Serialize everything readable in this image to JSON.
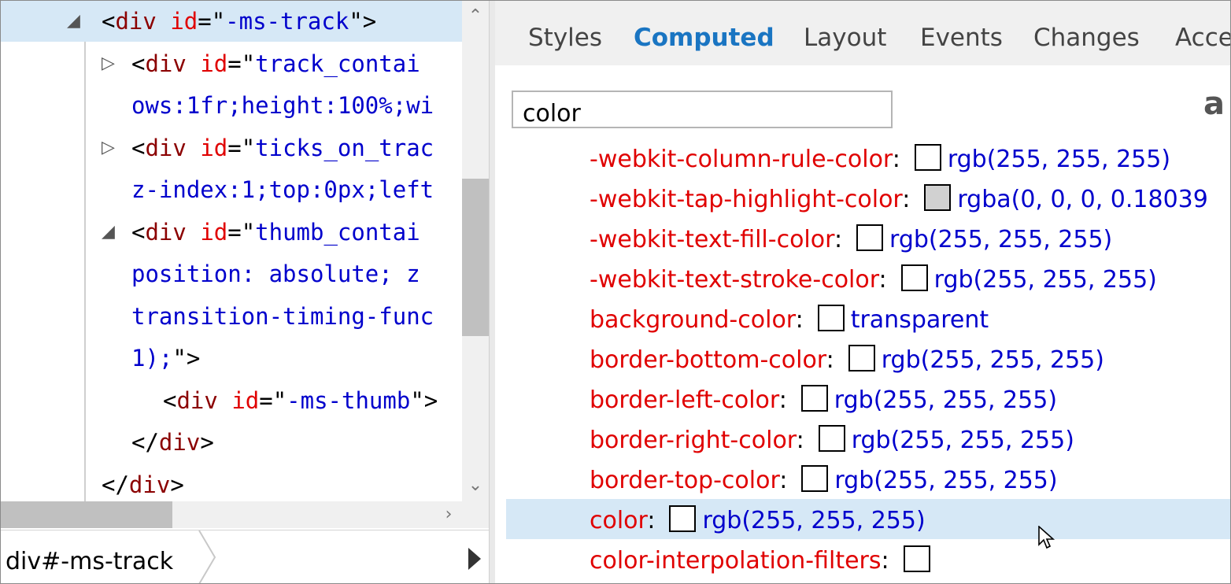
{
  "dom_tree": {
    "lines": [
      {
        "twisty": "expanded",
        "parts": [
          {
            "c": "punc",
            "t": "<"
          },
          {
            "c": "tag",
            "t": "div"
          },
          {
            "c": "punc",
            "t": " "
          },
          {
            "c": "attr",
            "t": "id"
          },
          {
            "c": "punc",
            "t": "=\""
          },
          {
            "c": "val",
            "t": "-ms-track"
          },
          {
            "c": "punc",
            "t": "\">"
          }
        ]
      },
      {
        "twisty": "collapsed",
        "parts": [
          {
            "c": "punc",
            "t": "<"
          },
          {
            "c": "tag",
            "t": "div"
          },
          {
            "c": "punc",
            "t": " "
          },
          {
            "c": "attr",
            "t": "id"
          },
          {
            "c": "punc",
            "t": "=\""
          },
          {
            "c": "val",
            "t": "track_contai"
          }
        ]
      },
      {
        "twisty": "",
        "parts": [
          {
            "c": "css",
            "t": "ows:1fr;height:100%;wi"
          }
        ]
      },
      {
        "twisty": "collapsed",
        "parts": [
          {
            "c": "punc",
            "t": "<"
          },
          {
            "c": "tag",
            "t": "div"
          },
          {
            "c": "punc",
            "t": " "
          },
          {
            "c": "attr",
            "t": "id"
          },
          {
            "c": "punc",
            "t": "=\""
          },
          {
            "c": "val",
            "t": "ticks_on_trac"
          }
        ]
      },
      {
        "twisty": "",
        "parts": [
          {
            "c": "css",
            "t": "z-index:1;top:0px;left"
          }
        ]
      },
      {
        "twisty": "expanded",
        "parts": [
          {
            "c": "punc",
            "t": "<"
          },
          {
            "c": "tag",
            "t": "div"
          },
          {
            "c": "punc",
            "t": " "
          },
          {
            "c": "attr",
            "t": "id"
          },
          {
            "c": "punc",
            "t": "=\""
          },
          {
            "c": "val",
            "t": "thumb_contai"
          }
        ]
      },
      {
        "twisty": "",
        "parts": [
          {
            "c": "css",
            "t": "position: absolute; z"
          }
        ]
      },
      {
        "twisty": "",
        "parts": [
          {
            "c": "css",
            "t": "transition-timing-func"
          }
        ]
      },
      {
        "twisty": "",
        "parts": [
          {
            "c": "css",
            "t": "1);"
          },
          {
            "c": "punc",
            "t": "\">"
          }
        ]
      },
      {
        "twisty": "",
        "parts": [
          {
            "c": "punc",
            "t": "<"
          },
          {
            "c": "tag",
            "t": "div"
          },
          {
            "c": "punc",
            "t": " "
          },
          {
            "c": "attr",
            "t": "id"
          },
          {
            "c": "punc",
            "t": "=\""
          },
          {
            "c": "val",
            "t": "-ms-thumb"
          },
          {
            "c": "punc",
            "t": "\">"
          }
        ]
      },
      {
        "twisty": "",
        "parts": [
          {
            "c": "punc",
            "t": "</"
          },
          {
            "c": "tag",
            "t": "div"
          },
          {
            "c": "punc",
            "t": ">"
          }
        ]
      },
      {
        "twisty": "",
        "parts": [
          {
            "c": "punc",
            "t": "</"
          },
          {
            "c": "tag",
            "t": "div"
          },
          {
            "c": "punc",
            "t": ">"
          }
        ]
      }
    ],
    "breadcrumb": "div#-ms-track"
  },
  "tabs": [
    "Styles",
    "Computed",
    "Layout",
    "Events",
    "Changes",
    "Acce"
  ],
  "active_tab": "Computed",
  "filter": {
    "value": "color"
  },
  "partial_icon_text": "a",
  "properties": [
    {
      "name": "-webkit-column-rule-color",
      "value": "rgb(255, 255, 255)",
      "swatch": "#ffffff"
    },
    {
      "name": "-webkit-tap-highlight-color",
      "value": "rgba(0, 0, 0, 0.18039",
      "swatch": "#d1d1d1"
    },
    {
      "name": "-webkit-text-fill-color",
      "value": "rgb(255, 255, 255)",
      "swatch": "#ffffff"
    },
    {
      "name": "-webkit-text-stroke-color",
      "value": "rgb(255, 255, 255)",
      "swatch": "#ffffff"
    },
    {
      "name": "background-color",
      "value": "transparent",
      "swatch": "#ffffff"
    },
    {
      "name": "border-bottom-color",
      "value": "rgb(255, 255, 255)",
      "swatch": "#ffffff"
    },
    {
      "name": "border-left-color",
      "value": "rgb(255, 255, 255)",
      "swatch": "#ffffff"
    },
    {
      "name": "border-right-color",
      "value": "rgb(255, 255, 255)",
      "swatch": "#ffffff"
    },
    {
      "name": "border-top-color",
      "value": "rgb(255, 255, 255)",
      "swatch": "#ffffff"
    },
    {
      "name": "color",
      "value": "rgb(255, 255, 255)",
      "swatch": "#ffffff"
    },
    {
      "name": "color-interpolation-filters",
      "value": "",
      "swatch": "#ffffff"
    }
  ],
  "colors": {
    "accent": "#1a75c2",
    "selection": "#d6e8f6",
    "prop_name": "#e00000",
    "prop_value": "#0000cc",
    "dom_tag": "#8b0000"
  }
}
